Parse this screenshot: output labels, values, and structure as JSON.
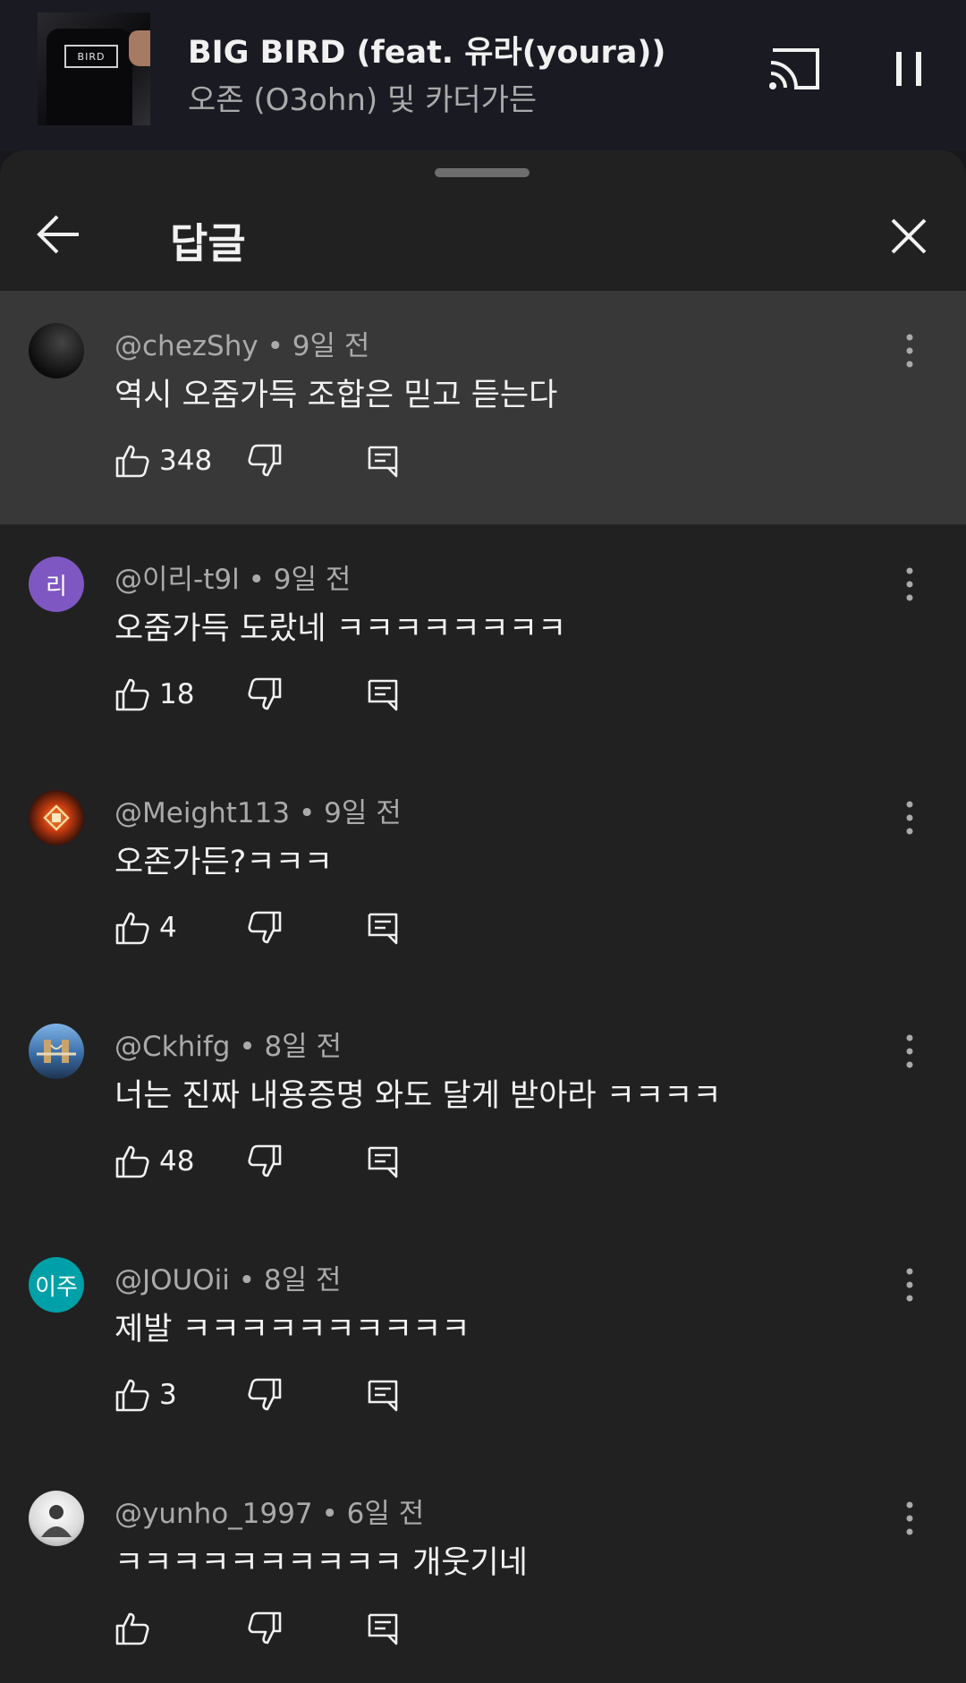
{
  "player": {
    "title": "BIG BIRD (feat. 유라(youra))",
    "artist": "오존 (O3ohn) 및 카더가든",
    "thumbnail_print": "BIRD"
  },
  "panel": {
    "title": "답글"
  },
  "comments": [
    {
      "author": "@chezShy",
      "time": "9일 전",
      "text": "역시 오줌가득 조합은 믿고 듣는다",
      "likes": "348",
      "avatar_initial": "",
      "avatar_color": "#1a1a1a"
    },
    {
      "author": "@이리-t9l",
      "time": "9일 전",
      "text": "오줌가득 도랐네 ㅋㅋㅋㅋㅋㅋㅋㅋ",
      "likes": "18",
      "avatar_initial": "리",
      "avatar_color": "#7e57c2"
    },
    {
      "author": "@Meight113",
      "time": "9일 전",
      "text": "오존가든?ㅋㅋㅋ",
      "likes": "4",
      "avatar_initial": "",
      "avatar_color": "#2b0f08"
    },
    {
      "author": "@Ckhifg",
      "time": "8일 전",
      "text": "너는 진짜 내용증명 와도 달게 받아라 ㅋㅋㅋㅋ",
      "likes": "48",
      "avatar_initial": "",
      "avatar_color": "#3b6ea8"
    },
    {
      "author": "@JOUOii",
      "time": "8일 전",
      "text": "제발 ㅋㅋㅋㅋㅋㅋㅋㅋㅋㅋ",
      "likes": "3",
      "avatar_initial": "이주",
      "avatar_color": "#00a0a8"
    },
    {
      "author": "@yunho_1997",
      "time": "6일 전",
      "text": "ㅋㅋㅋㅋㅋㅋㅋㅋㅋㅋ 개웃기네",
      "likes": "",
      "avatar_initial": "",
      "avatar_color": "#e9e9e9"
    }
  ],
  "colors": {
    "background": "#212121",
    "highlight_row": "#383838",
    "meta_text": "#aaaaaa",
    "primary_text": "#f1f1f1"
  },
  "icons": {
    "cast": "cast-icon",
    "pause": "pause-icon",
    "back": "arrow-left-icon",
    "close": "close-icon",
    "more": "more-vert-icon",
    "like": "thumb-up-icon",
    "dislike": "thumb-down-icon",
    "reply": "comment-icon"
  }
}
